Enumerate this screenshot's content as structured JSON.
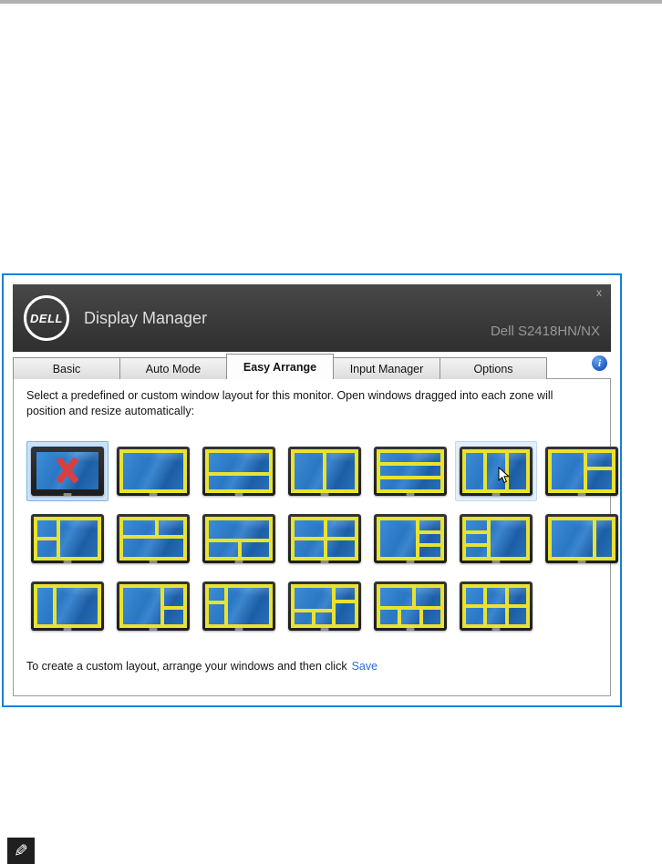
{
  "colors": {
    "window_border": "#1a7fd4",
    "zone_outline": "#e8e232",
    "selection_bg": "#cbe3f8",
    "selection_border": "#7fb2e0",
    "hover_bg": "#e2f0fb",
    "link": "#2b6cd9",
    "titlebar_bg": "#3a3a3a"
  },
  "window": {
    "titlebar": {
      "logo_text": "DELL",
      "title": "Display Manager",
      "model": "Dell S2418HN/NX",
      "close_label": "x"
    },
    "tabs": [
      {
        "label": "Basic",
        "active": false
      },
      {
        "label": "Auto Mode",
        "active": false
      },
      {
        "label": "Easy Arrange",
        "active": true
      },
      {
        "label": "Input Manager",
        "active": false
      },
      {
        "label": "Options",
        "active": false
      }
    ],
    "info_icon_label": "i",
    "content": {
      "instruction": "Select a predefined or custom window layout for this monitor.  Open windows dragged into each zone will position and resize automatically:",
      "footer_prefix": "To create a custom layout, arrange your windows and then click",
      "save_link": "Save",
      "layout_rows": [
        [
          {
            "name": "undo-no-layout",
            "type": "x",
            "selected": true
          },
          {
            "name": "1-zone-full",
            "zones": [
              [
                0,
                0,
                100,
                100
              ]
            ]
          },
          {
            "name": "2-rows",
            "zones": [
              [
                0,
                0,
                100,
                58
              ],
              [
                0,
                58,
                100,
                42
              ]
            ]
          },
          {
            "name": "2-columns",
            "zones": [
              [
                0,
                0,
                50,
                100
              ],
              [
                50,
                0,
                50,
                100
              ]
            ]
          },
          {
            "name": "3-rows",
            "zones": [
              [
                0,
                0,
                100,
                33
              ],
              [
                0,
                33,
                100,
                34
              ],
              [
                0,
                67,
                100,
                33
              ]
            ]
          },
          {
            "name": "3-columns",
            "hovered": true,
            "cursor": true,
            "zones": [
              [
                0,
                0,
                33,
                100
              ],
              [
                33,
                0,
                34,
                100
              ],
              [
                67,
                0,
                33,
                100
              ]
            ]
          },
          {
            "name": "left-large-right-2-stack",
            "zones": [
              [
                0,
                0,
                56,
                100
              ],
              [
                56,
                0,
                44,
                44
              ],
              [
                56,
                44,
                44,
                56
              ]
            ]
          }
        ],
        [
          {
            "name": "left-2-stack-right-large",
            "zones": [
              [
                0,
                0,
                36,
                50
              ],
              [
                0,
                50,
                36,
                50
              ],
              [
                36,
                0,
                64,
                100
              ]
            ]
          },
          {
            "name": "top-2-bottom-large",
            "zones": [
              [
                0,
                0,
                56,
                46
              ],
              [
                56,
                0,
                44,
                46
              ],
              [
                0,
                46,
                100,
                54
              ]
            ]
          },
          {
            "name": "top-large-bottom-2",
            "zones": [
              [
                0,
                0,
                100,
                54
              ],
              [
                0,
                54,
                52,
                46
              ],
              [
                52,
                54,
                48,
                46
              ]
            ]
          },
          {
            "name": "quad-grid",
            "zones": [
              [
                0,
                0,
                52,
                50
              ],
              [
                52,
                0,
                48,
                50
              ],
              [
                0,
                50,
                52,
                50
              ],
              [
                52,
                50,
                48,
                50
              ]
            ]
          },
          {
            "name": "left-large-right-3-stack",
            "zones": [
              [
                0,
                0,
                62,
                100
              ],
              [
                62,
                0,
                38,
                34
              ],
              [
                62,
                34,
                38,
                33
              ],
              [
                62,
                67,
                38,
                33
              ]
            ]
          },
          {
            "name": "left-3-stack-right-large",
            "zones": [
              [
                0,
                0,
                38,
                34
              ],
              [
                0,
                34,
                38,
                33
              ],
              [
                0,
                67,
                38,
                33
              ],
              [
                38,
                0,
                62,
                100
              ]
            ]
          },
          {
            "name": "left-large-right-column",
            "zones": [
              [
                0,
                0,
                70,
                100
              ],
              [
                70,
                0,
                30,
                100
              ]
            ]
          }
        ],
        [
          {
            "name": "left-column-right-large",
            "zones": [
              [
                0,
                0,
                30,
                100
              ],
              [
                30,
                0,
                70,
                100
              ]
            ]
          },
          {
            "name": "left-large-right-2-low",
            "zones": [
              [
                0,
                0,
                64,
                100
              ],
              [
                64,
                0,
                36,
                56
              ],
              [
                64,
                56,
                36,
                44
              ]
            ]
          },
          {
            "name": "left-2-high-right-large",
            "zones": [
              [
                0,
                0,
                30,
                42
              ],
              [
                0,
                42,
                30,
                58
              ],
              [
                30,
                0,
                70,
                100
              ]
            ]
          },
          {
            "name": "5-zones-mixed",
            "zones": [
              [
                0,
                0,
                64,
                62
              ],
              [
                0,
                62,
                33,
                38
              ],
              [
                33,
                62,
                31,
                38
              ],
              [
                64,
                0,
                36,
                40
              ],
              [
                64,
                40,
                36,
                60
              ]
            ]
          },
          {
            "name": "5-zones-2-top-3-bottom",
            "zones": [
              [
                0,
                0,
                56,
                56
              ],
              [
                56,
                0,
                44,
                56
              ],
              [
                0,
                56,
                33,
                44
              ],
              [
                33,
                56,
                34,
                44
              ],
              [
                67,
                56,
                33,
                44
              ]
            ]
          },
          {
            "name": "6-grid-3x2",
            "zones": [
              [
                0,
                0,
                33,
                50
              ],
              [
                33,
                0,
                34,
                50
              ],
              [
                67,
                0,
                33,
                50
              ],
              [
                0,
                50,
                33,
                50
              ],
              [
                33,
                50,
                34,
                50
              ],
              [
                67,
                50,
                33,
                50
              ]
            ]
          }
        ]
      ]
    }
  },
  "page": {
    "note_icon_glyph": "✎"
  }
}
